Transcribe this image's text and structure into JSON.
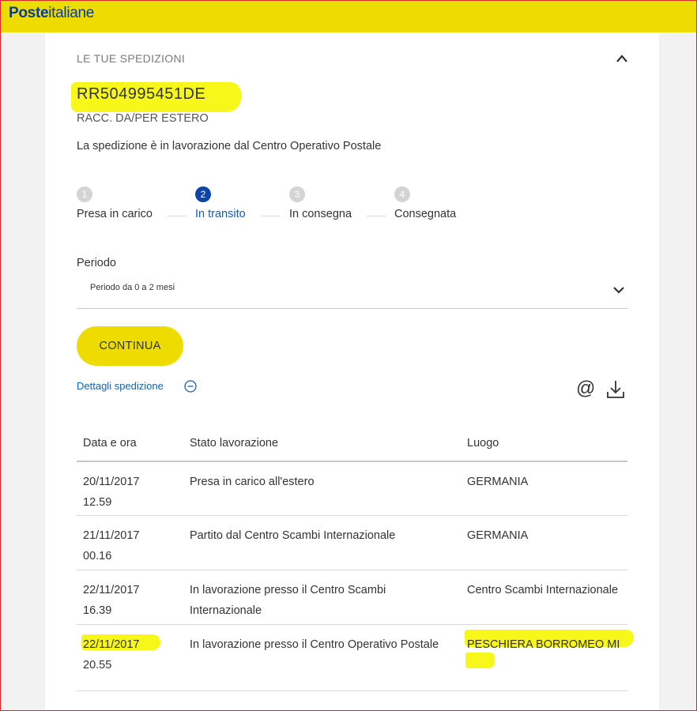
{
  "header": {
    "logo_bold": "Poste",
    "logo_light": "italiane",
    "brand_color": "#eedc00",
    "logo_color": "#0b3d91"
  },
  "panel": {
    "section_title": "LE TUE SPEDIZIONI",
    "collapse_icon": "chevron-up-icon",
    "tracking_number": "RR504995451DE",
    "service_type": "RACC. DA/PER ESTERO",
    "status_message": "La spedizione è in lavorazione dal Centro Operativo Postale"
  },
  "steps": [
    {
      "num": "1",
      "label": "Presa in carico",
      "active": false
    },
    {
      "num": "2",
      "label": "In transito",
      "active": true
    },
    {
      "num": "3",
      "label": "In consegna",
      "active": false
    },
    {
      "num": "4",
      "label": "Consegnata",
      "active": false
    }
  ],
  "filter": {
    "label": "Periodo",
    "selected": "Periodo da 0 a 2 mesi",
    "icon": "chevron-down-icon"
  },
  "actions": {
    "continue_label": "CONTINUA",
    "details_label": "Dettagli spedizione",
    "details_icon": "minus-circle-icon",
    "email_icon": "at-icon",
    "email_glyph": "@",
    "download_icon": "download-icon"
  },
  "table": {
    "headers": [
      "Data e ora",
      "Stato lavorazione",
      "Luogo"
    ],
    "rows": [
      {
        "date": "20/11/2017",
        "time": "12.59",
        "status": "Presa in carico all'estero",
        "place": "GERMANIA"
      },
      {
        "date": "21/11/2017",
        "time": "00.16",
        "status": "Partito dal Centro Scambi Internazionale",
        "place": "GERMANIA"
      },
      {
        "date": "22/11/2017",
        "time": "16.39",
        "status": "In lavorazione presso il Centro Scambi Internazionale",
        "place": "Centro Scambi Internazionale"
      },
      {
        "date": "22/11/2017",
        "time": "20.55",
        "status": "In lavorazione presso il Centro Operativo Postale",
        "place": "PESCHIERA BORROMEO MI"
      }
    ]
  },
  "annotation_color": "#f7f71a",
  "active_step_color": "#0b45a6",
  "link_color": "#1460b0"
}
